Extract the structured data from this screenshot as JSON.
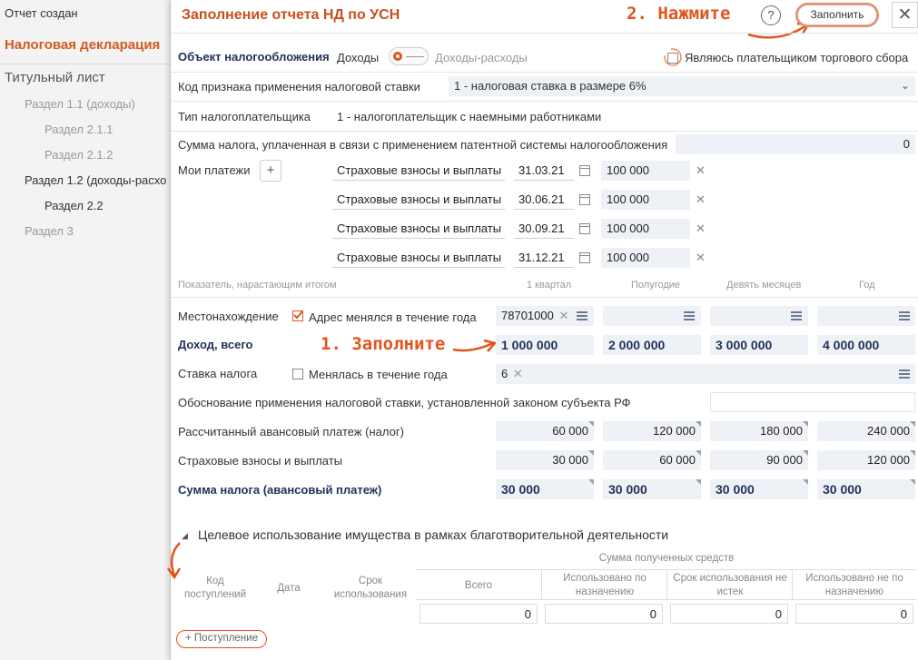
{
  "sidebar": {
    "status": "Отчет создан",
    "declaration": "Налоговая декларация",
    "title_page": "Титульный лист",
    "items": [
      {
        "label": "Раздел 1.1 (доходы)",
        "indent": 1,
        "state": "disabled"
      },
      {
        "label": "Раздел 2.1.1",
        "indent": 2,
        "state": "disabled"
      },
      {
        "label": "Раздел 2.1.2",
        "indent": 2,
        "state": "disabled"
      },
      {
        "label": "Раздел 1.2 (доходы-расхо",
        "indent": 1,
        "state": "active"
      },
      {
        "label": "Раздел 2.2",
        "indent": 2,
        "state": "active"
      },
      {
        "label": "Раздел 3",
        "indent": 1,
        "state": "disabled"
      }
    ]
  },
  "dialog": {
    "title": "Заполнение отчета НД по УСН",
    "help": "?",
    "fill_button": "Заполнить",
    "close": "✕",
    "annotation_2": "2. Нажмите",
    "annotation_1": "1. Заполните"
  },
  "object": {
    "label": "Объект налогообложения",
    "option_left": "Доходы",
    "option_right": "Доходы-расходы",
    "trade_fee_label": "Являюсь плательщиком торгового сбора"
  },
  "rate_code": {
    "label": "Код признака применения налоговой ставки",
    "value": "1 - налоговая ставка в размере 6%"
  },
  "taxpayer": {
    "label": "Тип налогоплательщика",
    "value": "1 - налогоплательщик с наемными работниками"
  },
  "patent": {
    "label": "Сумма налога, уплаченная в связи с применением патентной системы налогообложения",
    "value": "0"
  },
  "payments": {
    "label": "Мои платежи",
    "add": "+",
    "rows": [
      {
        "type": "Страховые взносы и выплаты",
        "date": "31.03.21",
        "amount": "100 000"
      },
      {
        "type": "Страховые взносы и выплаты",
        "date": "30.06.21",
        "amount": "100 000"
      },
      {
        "type": "Страховые взносы и выплаты",
        "date": "30.09.21",
        "amount": "100 000"
      },
      {
        "type": "Страховые взносы и выплаты",
        "date": "31.12.21",
        "amount": "100 000"
      }
    ]
  },
  "grid": {
    "header_label": "Показатель, нарастающим итогом",
    "periods": [
      "1 квартал",
      "Полугодие",
      "Девять месяцев",
      "Год"
    ],
    "location": {
      "label": "Местонахождение",
      "checkbox": "Адрес менялся в течение года",
      "q1": "78701000"
    },
    "income": {
      "label": "Доход, всего",
      "values": [
        "1 000 000",
        "2 000 000",
        "3 000 000",
        "4 000 000"
      ]
    },
    "rate": {
      "label": "Ставка налога",
      "checkbox": "Менялась в течение года",
      "value": "6"
    },
    "rationale": {
      "label": "Обоснование применения налоговой ставки, установленной законом субъекта РФ"
    },
    "advance": {
      "label": "Рассчитанный авансовый платеж (налог)",
      "values": [
        "60 000",
        "120 000",
        "180 000",
        "240 000"
      ]
    },
    "insurance": {
      "label": "Страховые взносы и выплаты",
      "values": [
        "30 000",
        "60 000",
        "90 000",
        "120 000"
      ]
    },
    "tax_sum": {
      "label": "Сумма налога (авансовый платеж)",
      "values": [
        "30 000",
        "30 000",
        "30 000",
        "30 000"
      ]
    }
  },
  "charity": {
    "title": "Целевое использование имущества в рамках благотворительной деятельности",
    "funds_header": "Сумма полученных средств",
    "cols": {
      "code": "Код поступлений",
      "date": "Дата",
      "term": "Срок использования",
      "total": "Всего",
      "used": "Использовано по назначению",
      "not_expired": "Срок использования не истек",
      "misused": "Использовано не по назначению"
    },
    "values": [
      "0",
      "0",
      "0",
      "0"
    ],
    "add_button": "+ Поступление"
  },
  "colors": {
    "accent": "#e2541c",
    "title": "#c8501c",
    "bold_label": "#22335a",
    "field_bg": "#eef1f6"
  }
}
